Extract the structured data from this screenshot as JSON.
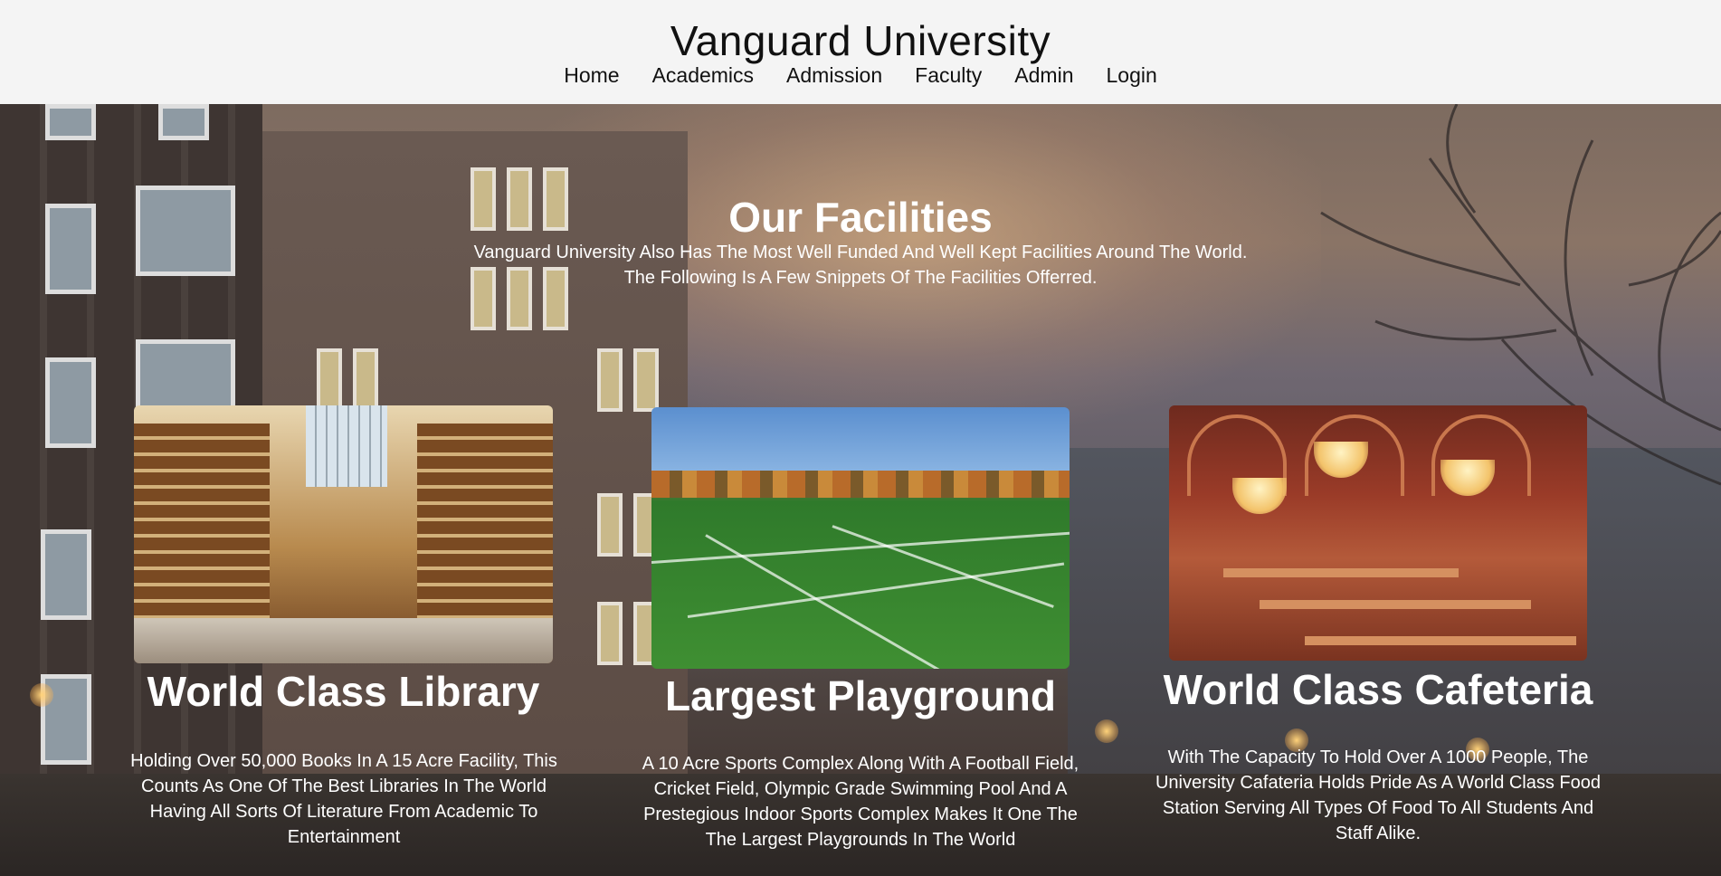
{
  "header": {
    "title": "Vanguard University",
    "nav": [
      "Home",
      "Academics",
      "Admission",
      "Faculty",
      "Admin",
      "Login"
    ]
  },
  "facilities": {
    "title": "Our Facilities",
    "description_line1": "Vanguard University Also Has The Most Well Funded And Well Kept Facilities Around The World.",
    "description_line2": "The Following Is A Few Snippets Of The Facilities Offerred.",
    "cards": [
      {
        "title": "World Class Library",
        "text": "Holding Over 50,000 Books In A 15 Acre Facility, This Counts As One Of The Best Libraries In The World Having All Sorts Of Literature From Academic To Entertainment"
      },
      {
        "title": "Largest Playground",
        "text": "A 10 Acre Sports Complex Along With A Football Field, Cricket Field, Olympic Grade Swimming Pool And A Prestegious Indoor Sports Complex Makes It One The The Largest Playgrounds In The World"
      },
      {
        "title": "World Class Cafeteria",
        "text": "With The Capacity To Hold Over A 1000 People, The University Cafateria Holds Pride As A World Class Food Station Serving All Types Of Food To All Students And Staff Alike."
      }
    ]
  },
  "colors": {
    "header_bg": "#f4f4f4",
    "header_text": "#111111",
    "hero_text": "#ffffff"
  }
}
